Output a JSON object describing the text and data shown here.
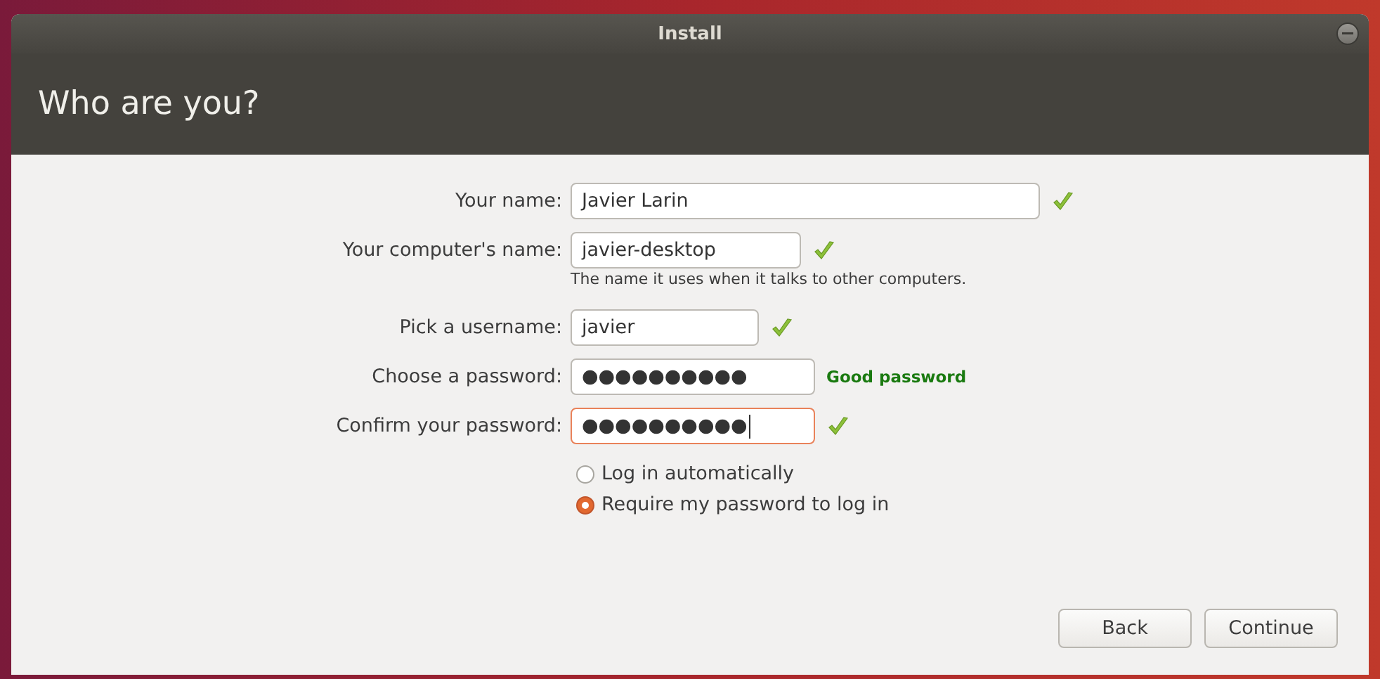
{
  "window": {
    "title": "Install"
  },
  "header": {
    "title": "Who are you?"
  },
  "fields": [
    {
      "label": "Your name:",
      "value": "Javier Larin",
      "valid": true,
      "focused": false
    },
    {
      "label": "Your computer's name:",
      "value": "javier-desktop",
      "valid": true,
      "focused": false,
      "hint": "The name it uses when it talks to other computers."
    },
    {
      "label": "Pick a username:",
      "value": "javier",
      "valid": true,
      "focused": false
    },
    {
      "label": "Choose a password:",
      "value": "●●●●●●●●●●",
      "valid": false,
      "focused": false,
      "strength": "Good password"
    },
    {
      "label": "Confirm your password:",
      "value": "●●●●●●●●●●",
      "valid": true,
      "focused": true
    }
  ],
  "login_options": [
    {
      "label": "Log in automatically",
      "selected": false
    },
    {
      "label": "Require my password to log in",
      "selected": true
    }
  ],
  "buttons": [
    "Back",
    "Continue"
  ]
}
